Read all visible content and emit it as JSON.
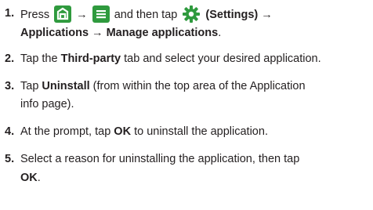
{
  "icons": {
    "home": "home-key-icon",
    "menu": "menu-key-icon",
    "settings": "settings-gear-icon"
  },
  "colors": {
    "icon_green": "#2f9a3e",
    "text": "#231f20"
  },
  "steps": [
    {
      "num": "1.",
      "l1_a": "Press",
      "arrow1": "→",
      "l1_b": "and then tap",
      "l1_c": "(Settings)",
      "arrow2": "→",
      "l2_a": "Applications",
      "arrow3": "→",
      "l2_b": "Manage applications",
      "l2_c": "."
    },
    {
      "num": "2.",
      "a": "Tap the ",
      "b": "Third-party",
      "c": " tab and select your desired application."
    },
    {
      "num": "3.",
      "a": "Tap ",
      "b": "Uninstall",
      "c": " (from within the top area of the Application",
      "l2": "info page)."
    },
    {
      "num": "4.",
      "a": "At the prompt, tap ",
      "b": "OK",
      "c": " to uninstall the application."
    },
    {
      "num": "5.",
      "a": "Select a reason for uninstalling the application, then tap",
      "l2_b": "OK",
      "l2_c": "."
    }
  ]
}
